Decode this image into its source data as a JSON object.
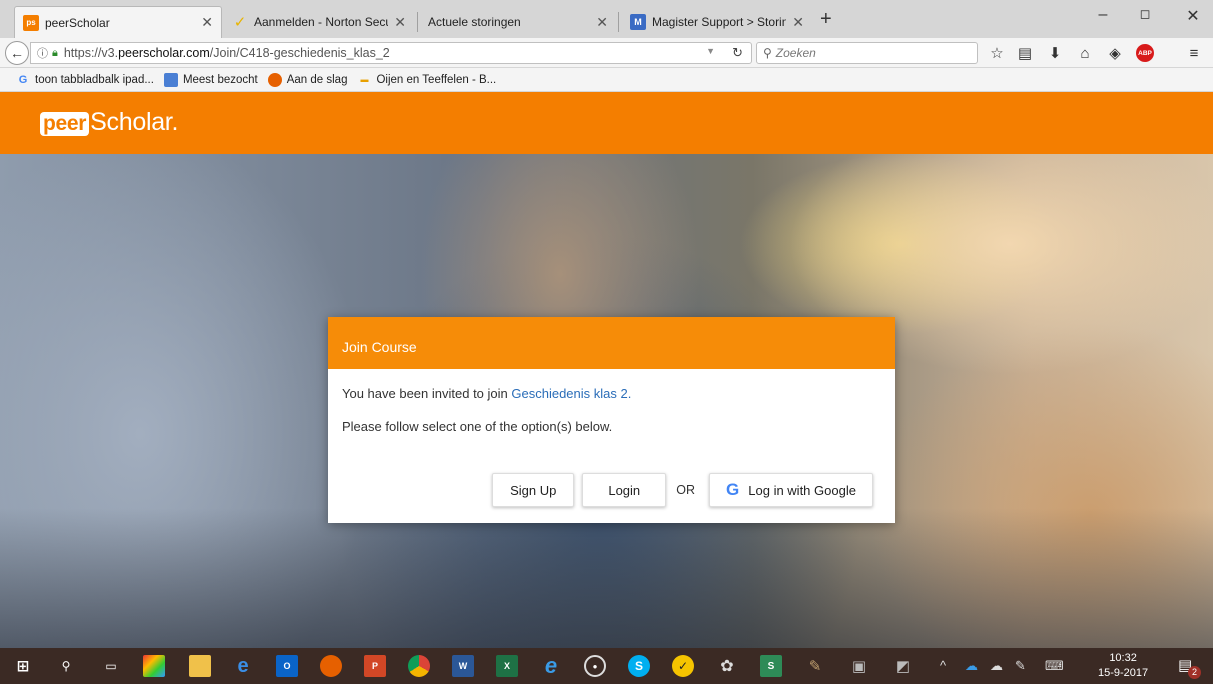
{
  "browser": {
    "tabs": [
      {
        "title": "peerScholar",
        "active": true,
        "icon": "peerscholar-favicon"
      },
      {
        "title": "Aanmelden - Norton Secure",
        "active": false,
        "icon": "norton-check-icon"
      },
      {
        "title": "Actuele storingen",
        "active": false,
        "icon": ""
      },
      {
        "title": "Magister Support > Storinge",
        "active": false,
        "icon": "magister-favicon"
      }
    ],
    "new_tab": "+",
    "window_controls": {
      "minimize": "–",
      "restore": "◻",
      "close": "✕"
    },
    "url": {
      "prefix": "https://v3.",
      "domain": "peerscholar.com",
      "path": "/Join/C418-geschiedenis_klas_2"
    },
    "search_placeholder": "Zoeken",
    "toolbar_icons": [
      "bookmark-star-icon",
      "reading-list-icon",
      "download-icon",
      "home-icon",
      "pocket-icon",
      "adblock-plus-icon",
      "menu-icon"
    ],
    "adblock_label": "ABP",
    "bookmarks": [
      {
        "label": "toon tabbladbalk ipad...",
        "icon": "google-g-icon"
      },
      {
        "label": "Meest bezocht",
        "icon": "most-visited-icon"
      },
      {
        "label": "Aan de slag",
        "icon": "firefox-icon"
      },
      {
        "label": "Oijen en Teeffelen - B...",
        "icon": "site-icon"
      }
    ]
  },
  "site": {
    "logo_peer": "peer",
    "logo_scholar": "Scholar."
  },
  "modal": {
    "title": "Join Course",
    "invite_text": "You have been invited to join ",
    "course_link": "Geschiedenis klas 2.",
    "instruction": "Please follow select one of the option(s) below.",
    "signup_label": "Sign Up",
    "login_label": "Login",
    "or_label": "OR",
    "google_label": "Log in with Google"
  },
  "taskbar": {
    "time": "10:32",
    "date": "15-9-2017",
    "notification_count": "2"
  },
  "colors": {
    "brand_orange": "#f47e00",
    "modal_header": "#f68c08",
    "link_blue": "#2a6db8"
  }
}
